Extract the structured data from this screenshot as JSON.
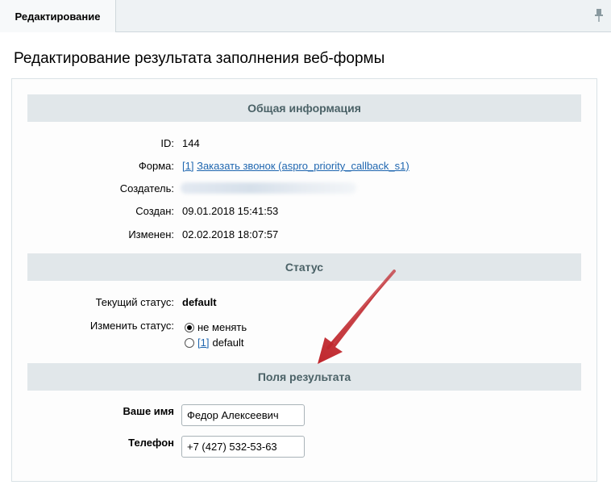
{
  "tab": {
    "label": "Редактирование"
  },
  "page": {
    "title": "Редактирование результата заполнения веб-формы"
  },
  "sections": {
    "general": "Общая информация",
    "status": "Статус",
    "fields": "Поля результата"
  },
  "general": {
    "id_label": "ID:",
    "id_value": "144",
    "form_label": "Форма:",
    "form_id_link": "[1]",
    "form_name_link": "Заказать звонок (aspro_priority_callback_s1)",
    "creator_label": "Создатель:",
    "created_label": "Создан:",
    "created_value": "09.01.2018 15:41:53",
    "modified_label": "Изменен:",
    "modified_value": "02.02.2018 18:07:57"
  },
  "status": {
    "current_label": "Текущий статус:",
    "current_value": "default",
    "change_label": "Изменить статус:",
    "option_keep": "не менять",
    "option_default_link": "[1]",
    "option_default_text": "default",
    "selected": "не менять"
  },
  "fields": {
    "name_label": "Ваше имя",
    "name_value": "Федор Алексеевич",
    "phone_label": "Телефон",
    "phone_value": "+7 (427) 532-53-63"
  },
  "colors": {
    "section_bg": "#e1e7ea",
    "section_text": "#4b6267",
    "link": "#2067b0",
    "annotation_arrow": "#c0272d"
  },
  "icons": {
    "pin": "pin-icon"
  }
}
